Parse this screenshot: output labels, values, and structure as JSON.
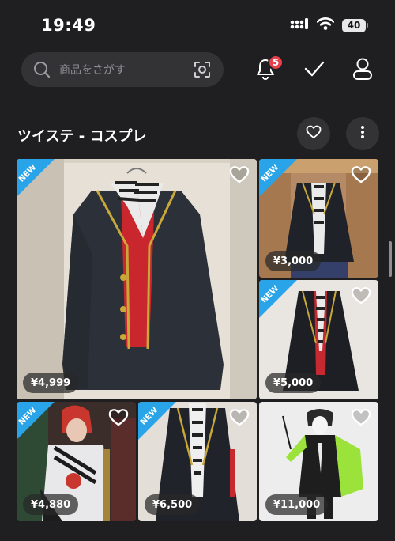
{
  "status_bar": {
    "time": "19:49",
    "battery": "40"
  },
  "search": {
    "placeholder": "商品をさがす"
  },
  "notifications": {
    "badge_count": "5"
  },
  "list": {
    "title": "ツイステ - コスプレ"
  },
  "items": [
    {
      "new_label": "NEW",
      "price": "¥4,999"
    },
    {
      "new_label": "NEW",
      "price": "¥3,000"
    },
    {
      "new_label": "NEW",
      "price": "¥5,000"
    },
    {
      "new_label": "NEW",
      "price": "¥4,880"
    },
    {
      "new_label": "NEW",
      "price": "¥6,500"
    },
    {
      "price": "¥11,000"
    }
  ],
  "colors": {
    "background": "#1f1f22",
    "new_tag": "#2aa4e8",
    "badge": "#e5404c"
  }
}
